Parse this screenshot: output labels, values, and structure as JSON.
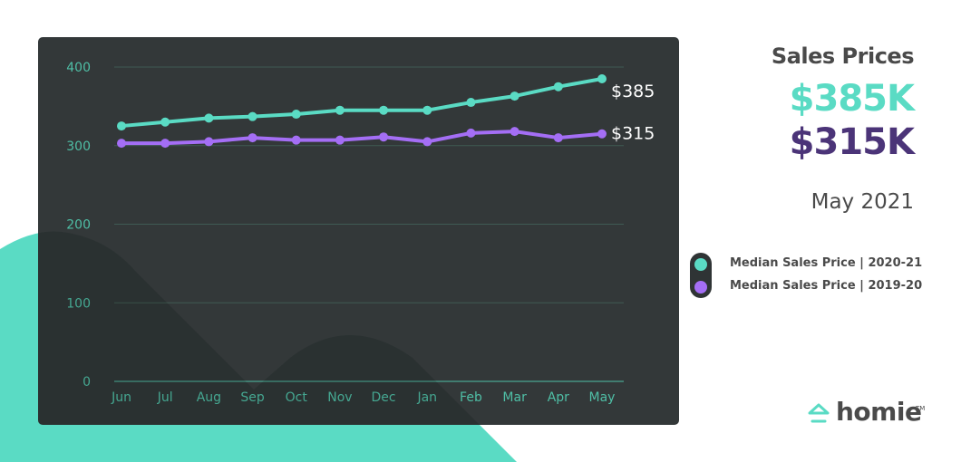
{
  "colors": {
    "series1": "#5adbc4",
    "series2": "#a46ef5",
    "card": "#2f3435",
    "axis_text": "#4fbfa6",
    "gridline": "#3f5a53",
    "big2_text": "#4b3478",
    "text": "#4a4a4a"
  },
  "header": {
    "title": "Sales Prices",
    "value_current": "$385K",
    "value_previous": "$315K",
    "period": "May 2021"
  },
  "legend": [
    {
      "label": "Median Sales Price  |  2020-21",
      "color": "#5adbc4"
    },
    {
      "label": "Median Sales Price  |  2019-20",
      "color": "#a46ef5"
    }
  ],
  "logo": {
    "name": "homie",
    "tm": "TM"
  },
  "chart_data": {
    "type": "line",
    "title": "Sales Prices",
    "xlabel": "",
    "ylabel": "",
    "categories": [
      "Jun",
      "Jul",
      "Aug",
      "Sep",
      "Oct",
      "Nov",
      "Dec",
      "Jan",
      "Feb",
      "Mar",
      "Apr",
      "May"
    ],
    "yticks": [
      0,
      100,
      200,
      300,
      400
    ],
    "ylim": [
      0,
      400
    ],
    "grid": true,
    "series": [
      {
        "name": "Median Sales Price | 2020-21",
        "color": "#5adbc4",
        "end_label": "$385",
        "values": [
          325,
          330,
          335,
          337,
          340,
          345,
          345,
          345,
          355,
          363,
          375,
          385
        ]
      },
      {
        "name": "Median Sales Price | 2019-20",
        "color": "#a46ef5",
        "end_label": "$315",
        "values": [
          303,
          303,
          305,
          310,
          307,
          307,
          311,
          305,
          316,
          318,
          310,
          315
        ]
      }
    ],
    "legend_position": "right"
  }
}
